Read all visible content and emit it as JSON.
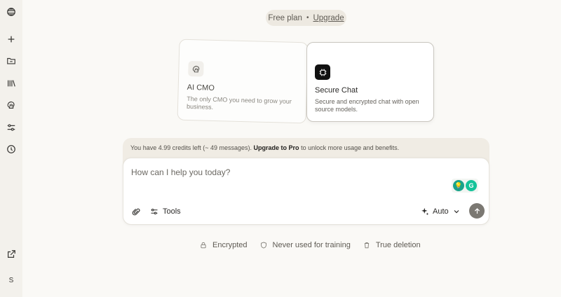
{
  "plan": {
    "label": "Free plan",
    "separator": "•",
    "upgrade_label": "Upgrade"
  },
  "cards": [
    {
      "title": "AI CMO",
      "description": "The only CMO you need to grow your business.",
      "icon": "brain-icon"
    },
    {
      "title": "Secure Chat",
      "description": "Secure and encrypted chat with open source models.",
      "icon": "chip-icon"
    }
  ],
  "credits": {
    "prefix": "You have 4.99 credits left (~ 49 messages).",
    "cta": "Upgrade to Pro",
    "suffix": "to unlock more usage and benefits."
  },
  "composer": {
    "placeholder": "How can I help you today?",
    "tools_label": "Tools",
    "model_label": "Auto"
  },
  "features": [
    {
      "label": "Encrypted",
      "icon": "lock-icon"
    },
    {
      "label": "Never used for training",
      "icon": "shield-icon"
    },
    {
      "label": "True deletion",
      "icon": "trash-icon"
    }
  ],
  "sidebar": {
    "avatar_initial": "S",
    "items": [
      "logo-icon",
      "new-chat-icon",
      "folder-icon",
      "library-icon",
      "brain-icon",
      "settings-sliders-icon",
      "history-icon"
    ]
  },
  "colors": {
    "background": "#faf9f6",
    "sidebar": "#f3f1ec",
    "send_button": "#7b7872"
  }
}
